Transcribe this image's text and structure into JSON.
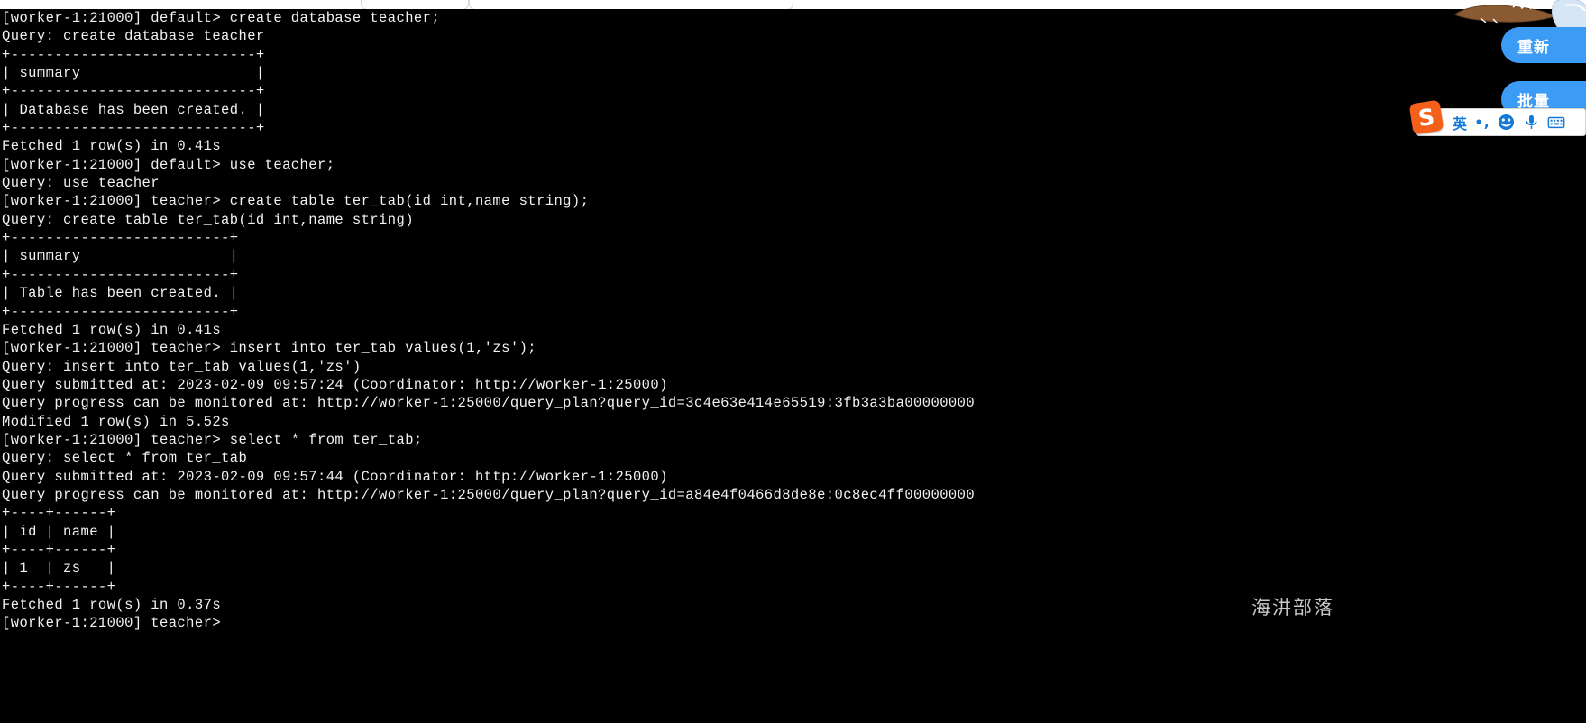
{
  "window": {
    "background_color": "#000000",
    "text_color": "#f2f2f2",
    "accent_color": "#3c9cf5"
  },
  "terminal": {
    "prompt_host": "worker-1:21000",
    "lines": [
      "[worker-1:21000] default> create database teacher;",
      "Query: create database teacher",
      "+----------------------------+",
      "| summary                    |",
      "+----------------------------+",
      "| Database has been created. |",
      "+----------------------------+",
      "Fetched 1 row(s) in 0.41s",
      "[worker-1:21000] default> use teacher;",
      "Query: use teacher",
      "[worker-1:21000] teacher> create table ter_tab(id int,name string);",
      "Query: create table ter_tab(id int,name string)",
      "+-------------------------+",
      "| summary                 |",
      "+-------------------------+",
      "| Table has been created. |",
      "+-------------------------+",
      "Fetched 1 row(s) in 0.41s",
      "[worker-1:21000] teacher> insert into ter_tab values(1,'zs');",
      "Query: insert into ter_tab values(1,'zs')",
      "Query submitted at: 2023-02-09 09:57:24 (Coordinator: http://worker-1:25000)",
      "Query progress can be monitored at: http://worker-1:25000/query_plan?query_id=3c4e63e414e65519:3fb3a3ba00000000",
      "Modified 1 row(s) in 5.52s",
      "[worker-1:21000] teacher> select * from ter_tab;",
      "Query: select * from ter_tab",
      "Query submitted at: 2023-02-09 09:57:44 (Coordinator: http://worker-1:25000)",
      "Query progress can be monitored at: http://worker-1:25000/query_plan?query_id=a84e4f0466d8de8e:0c8ec4ff00000000",
      "+----+------+",
      "| id | name |",
      "+----+------+",
      "| 1  | zs   |",
      "+----+------+",
      "Fetched 1 row(s) in 0.37s",
      "[worker-1:21000] teacher>"
    ]
  },
  "watermark": {
    "text": "海汫部落"
  },
  "floating_buttons": [
    {
      "label": "重新",
      "name": "restart-button"
    },
    {
      "label": "批量",
      "name": "batch-button"
    }
  ],
  "ime": {
    "logo_letter": "S",
    "language_label": "英",
    "punctuation_label": "•,",
    "emoji_icon": "emoji-icon",
    "voice_icon": "microphone-icon",
    "keyboard_icon": "keyboard-icon"
  }
}
